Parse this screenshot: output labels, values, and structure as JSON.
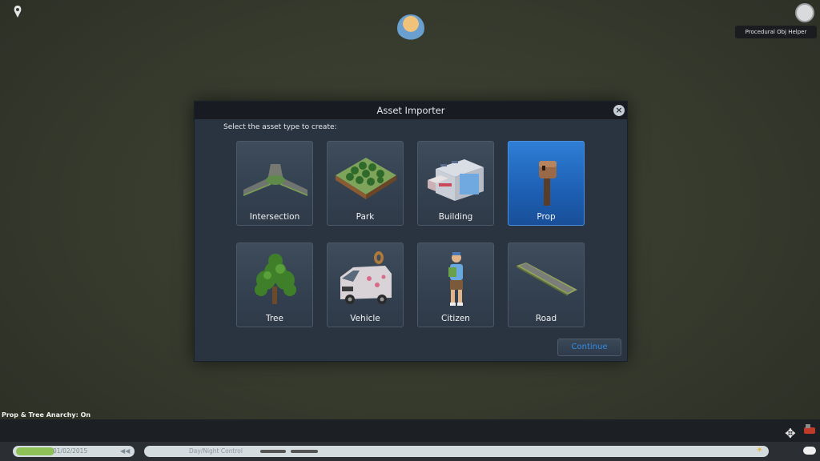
{
  "overlays": {
    "top_right_label": "Procedural Obj Helper"
  },
  "modal": {
    "title": "Asset Importer",
    "close_icon": "×",
    "instruction": "Select the asset type to create:",
    "tiles": [
      {
        "label": "Intersection",
        "icon": "intersection-icon",
        "selected": false
      },
      {
        "label": "Park",
        "icon": "park-icon",
        "selected": false
      },
      {
        "label": "Building",
        "icon": "building-icon",
        "selected": false
      },
      {
        "label": "Prop",
        "icon": "prop-icon",
        "selected": true
      },
      {
        "label": "Tree",
        "icon": "tree-icon",
        "selected": false
      },
      {
        "label": "Vehicle",
        "icon": "vehicle-icon",
        "selected": false
      },
      {
        "label": "Citizen",
        "icon": "citizen-icon",
        "selected": false
      },
      {
        "label": "Road",
        "icon": "road-icon",
        "selected": false
      }
    ],
    "continue_label": "Continue"
  },
  "bottom": {
    "anarchy_status": "Prop & Tree Anarchy: On",
    "date": "01/02/2015",
    "play_controls": "◀◀",
    "daynight_label": "Day/Night Control"
  },
  "colors": {
    "accent": "#2f8ee8",
    "selected_tile": "#1d5fb3"
  }
}
